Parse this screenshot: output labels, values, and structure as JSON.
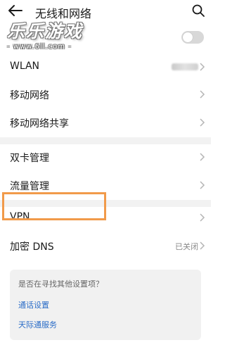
{
  "header": {
    "title": "无线和网络"
  },
  "watermark": {
    "brand": "乐乐游戏",
    "url": "- www.6ll.com -"
  },
  "rows": {
    "wlan": {
      "label": "WLAN"
    },
    "mobile_network": {
      "label": "移动网络"
    },
    "mobile_hotspot": {
      "label": "移动网络共享"
    },
    "dual_sim": {
      "label": "双卡管理"
    },
    "data_usage": {
      "label": "流量管理"
    },
    "vpn": {
      "label": "VPN"
    },
    "private_dns": {
      "label": "加密 DNS",
      "value": "已关闭"
    }
  },
  "suggestions": {
    "title": "是否在寻找其他设置项？",
    "links": [
      "通话设置",
      "天际通服务"
    ]
  },
  "colors": {
    "link": "#2a6cc7",
    "highlight": "#f19a4a",
    "section_bg": "#f2f2f2"
  },
  "icons": [
    "back-arrow-icon",
    "search-icon",
    "chevron-right-icon"
  ]
}
